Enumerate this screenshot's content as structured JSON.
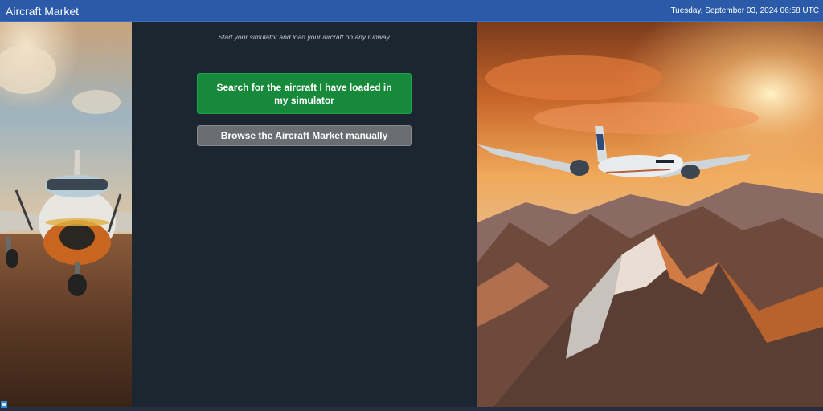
{
  "titlebar": {
    "title": "Aircraft Market",
    "datetime": "Tuesday, September 03, 2024 06:58 UTC"
  },
  "main": {
    "instruction": "Start your simulator and load your aircraft on any runway.",
    "search_button_label": "Search for the aircraft I have loaded in my simulator",
    "browse_button_label": "Browse the Aircraft Market manually"
  },
  "images": {
    "left": "private-propeller-aircraft-on-tarmac-photo",
    "right": "airliner-over-mountains-sunset-photo"
  },
  "icons": {
    "corner": "app-corner-icon"
  },
  "colors": {
    "titlebar_bg": "#2a5aa8",
    "panel_bg": "#1c2631",
    "primary_button": "#168a3a",
    "secondary_button": "#6a6d71"
  }
}
